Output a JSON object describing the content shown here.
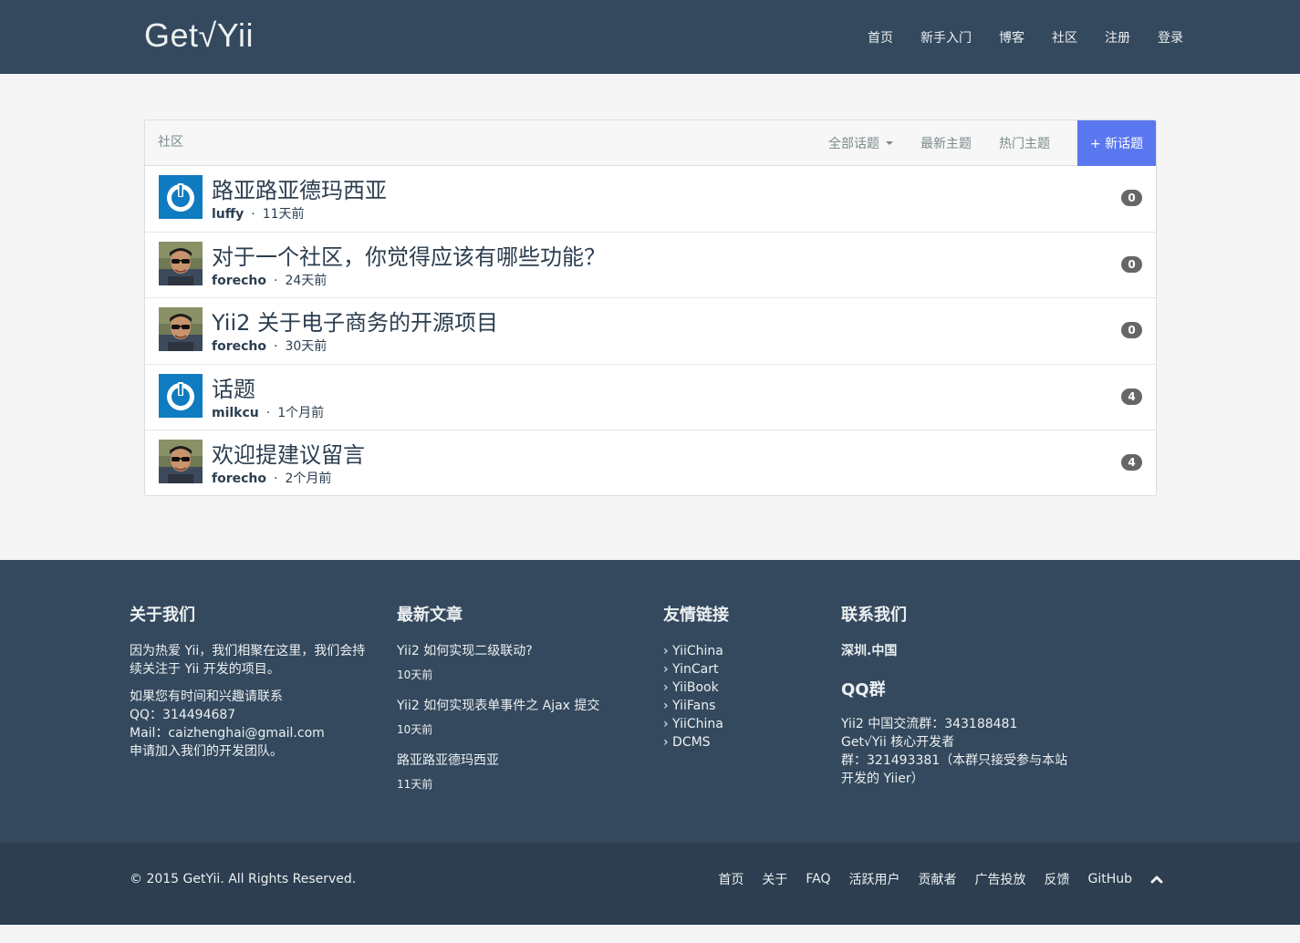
{
  "header": {
    "brand": "Get√Yii",
    "nav": [
      "首页",
      "新手入门",
      "博客",
      "社区",
      "注册",
      "登录"
    ]
  },
  "panel": {
    "title": "社区",
    "filter_all": "全部话题",
    "filter_latest": "最新主题",
    "filter_hot": "热门主题",
    "new_topic": "+ 新话题"
  },
  "topics": [
    {
      "title": "路亚路亚德玛西亚",
      "user": "luffy",
      "time": "11天前",
      "count": "0",
      "avatar": "power-logo"
    },
    {
      "title": "对于一个社区，你觉得应该有哪些功能？",
      "user": "forecho",
      "time": "24天前",
      "count": "0",
      "avatar": "user-photo"
    },
    {
      "title": "Yii2 关于电子商务的开源项目",
      "user": "forecho",
      "time": "30天前",
      "count": "0",
      "avatar": "user-photo"
    },
    {
      "title": "话题",
      "user": "milkcu",
      "time": "1个月前",
      "count": "4",
      "avatar": "power-logo"
    },
    {
      "title": "欢迎提建议留言",
      "user": "forecho",
      "time": "2个月前",
      "count": "4",
      "avatar": "user-photo"
    }
  ],
  "footer": {
    "about": {
      "heading": "关于我们",
      "text1": "因为热爱 Yii，我们相聚在这里，我们会持续关注于 Yii 开发的项目。",
      "line1": "如果您有时间和兴趣请联系",
      "line2": "QQ：314494687",
      "line3": "Mail：caizhenghai@gmail.com",
      "line4": "申请加入我们的开发团队。"
    },
    "articles": {
      "heading": "最新文章",
      "items": [
        {
          "title": "Yii2 如何实现二级联动?",
          "time": "10天前"
        },
        {
          "title": "Yii2 如何实现表单事件之 Ajax 提交",
          "time": "10天前"
        },
        {
          "title": "路亚路亚德玛西亚",
          "time": "11天前"
        }
      ]
    },
    "links": {
      "heading": "友情链接",
      "items": [
        "› YiiChina",
        "› YinCart",
        "› YiiBook",
        "› YiiFans",
        "› YiiChina",
        "› DCMS"
      ]
    },
    "contact": {
      "heading": "联系我们",
      "city": "深圳.中国",
      "qq_heading": "QQ群",
      "g1": "Yii2 中国交流群：343188481",
      "g2": "Get√Yii 核心开发者",
      "g3": "群：321493381（本群只接受参与本站",
      "g4": "开发的 Yiier）"
    }
  },
  "bottom": {
    "copyright": "© 2015 GetYii. All Rights Reserved.",
    "links": [
      "首页",
      "关于",
      "FAQ",
      "活跃用户",
      "贡献者",
      "广告投放",
      "反馈",
      "GitHub"
    ]
  },
  "colors": {
    "navbar": "#34495e",
    "accent": "#5a77f0",
    "footer_bottom": "#2c3e50",
    "avatar_blue": "#0f7bc1"
  }
}
